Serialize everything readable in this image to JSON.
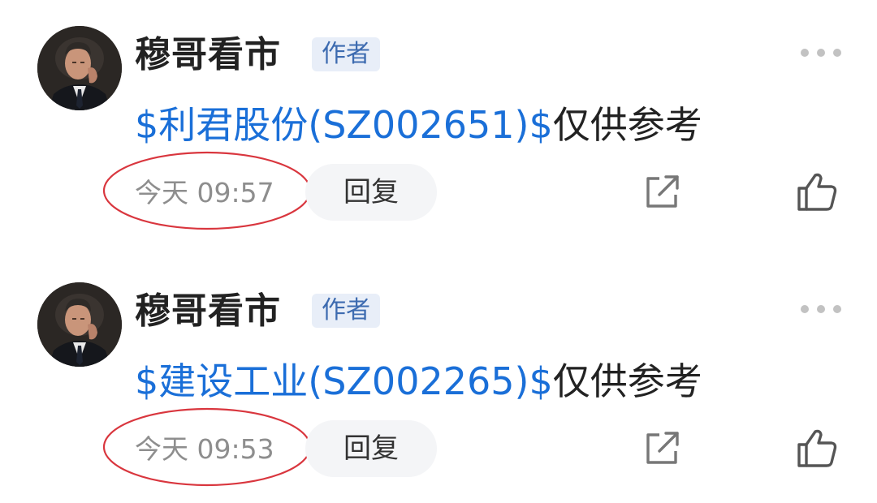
{
  "posts": [
    {
      "author": "穆哥看市",
      "author_badge": "作者",
      "stock": "$利君股份(SZ002651)$",
      "text": "仅供参考",
      "time": "今天 09:57",
      "reply_label": "回复",
      "avatar_icon": "avatar-portrait",
      "more_icon": "more-dots-icon",
      "share_icon": "share-icon",
      "like_icon": "thumbs-up-icon",
      "highlight_color": "#d9363e"
    },
    {
      "author": "穆哥看市",
      "author_badge": "作者",
      "stock": "$建设工业(SZ002265)$",
      "text": "仅供参考",
      "time": "今天 09:53",
      "reply_label": "回复",
      "avatar_icon": "avatar-portrait",
      "more_icon": "more-dots-icon",
      "share_icon": "share-icon",
      "like_icon": "thumbs-up-icon",
      "highlight_color": "#d9363e"
    }
  ],
  "colors": {
    "stock_link": "#1a6fd8",
    "badge_text": "#3d6bb0",
    "badge_bg": "#e8eef8",
    "timestamp": "#8e8e8e"
  }
}
